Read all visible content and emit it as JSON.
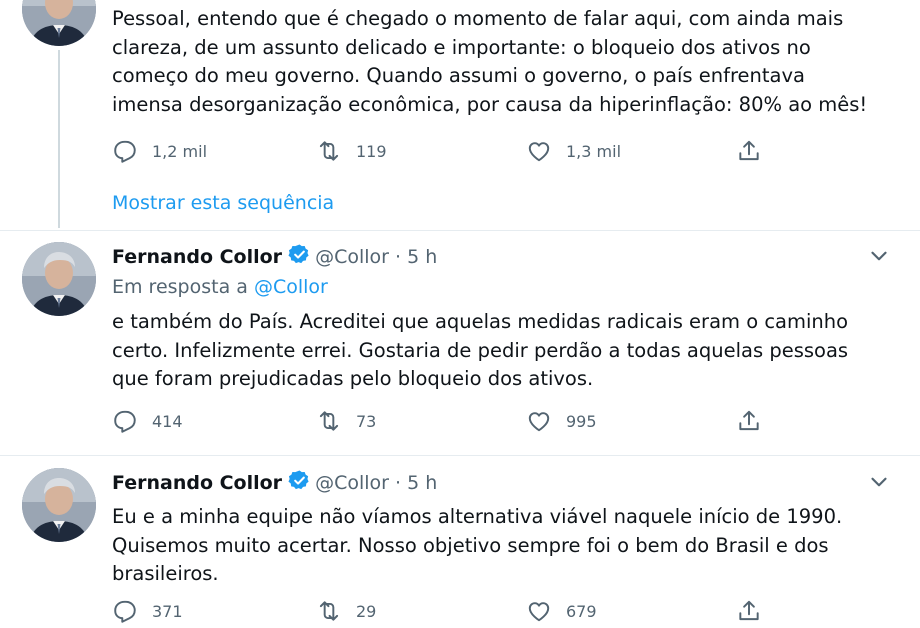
{
  "tweets": [
    {
      "text": "Pessoal, entendo que é chegado o momento de falar aqui, com ainda mais\nclareza, de um assunto delicado e importante: o bloqueio dos ativos no\ncomeço do meu governo. Quando assumi o governo, o país enfrentava\nimensa desorganização econômica, por causa da hiperinflação: 80% ao mês!",
      "replies": "1,2 mil",
      "retweets": "119",
      "likes": "1,3 mil",
      "show_thread": "Mostrar esta sequência"
    },
    {
      "name": "Fernando Collor",
      "handle": "@Collor",
      "sep": "·",
      "time": "5 h",
      "reply_prefix": "Em resposta a",
      "reply_mention": "@Collor",
      "text": "e também do País. Acreditei que aquelas medidas radicais eram o caminho\ncerto. Infelizmente errei. Gostaria de pedir perdão a todas aquelas pessoas\nque foram prejudicadas pelo bloqueio dos ativos.",
      "replies": "414",
      "retweets": "73",
      "likes": "995"
    },
    {
      "name": "Fernando Collor",
      "handle": "@Collor",
      "sep": "·",
      "time": "5 h",
      "text": "Eu e a minha equipe não víamos alternativa viável naquele início de 1990.\nQuisemos muito acertar. Nosso objetivo sempre foi o bem do Brasil e dos\nbrasileiros.",
      "replies": "371",
      "retweets": "29",
      "likes": "679"
    }
  ],
  "icons": {
    "reply": "reply-icon",
    "retweet": "retweet-icon",
    "like": "heart-icon",
    "share": "share-icon",
    "more": "chevron-down-icon",
    "verified": "verified-badge-icon"
  },
  "colors": {
    "accent": "#1d9bf0",
    "secondary_text": "#536471",
    "primary_text": "#0f1419",
    "thread_line": "#cfd9de"
  }
}
